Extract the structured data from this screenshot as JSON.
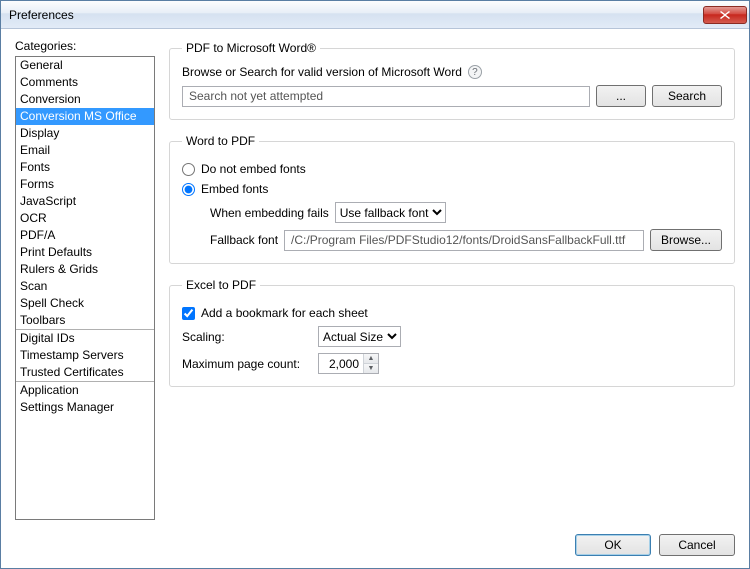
{
  "window": {
    "title": "Preferences"
  },
  "sidebar": {
    "label": "Categories:",
    "groups": [
      [
        "General",
        "Comments",
        "Conversion",
        "Conversion MS Office",
        "Display",
        "Email",
        "Fonts",
        "Forms",
        "JavaScript",
        "OCR",
        "PDF/A",
        "Print Defaults",
        "Rulers & Grids",
        "Scan",
        "Spell Check",
        "Toolbars"
      ],
      [
        "Digital IDs",
        "Timestamp Servers",
        "Trusted Certificates"
      ],
      [
        "Application",
        "Settings Manager"
      ]
    ],
    "selected": "Conversion MS Office"
  },
  "pdf_to_word": {
    "legend": "PDF to Microsoft Word®",
    "prompt": "Browse or Search for valid version of Microsoft Word",
    "status": "Search not yet attempted",
    "browse_label": "...",
    "search_label": "Search"
  },
  "word_to_pdf": {
    "legend": "Word to PDF",
    "radio_no_embed": "Do not embed fonts",
    "radio_embed": "Embed fonts",
    "embed_selected": true,
    "when_fails_label": "When embedding fails",
    "when_fails_value": "Use fallback font",
    "fallback_label": "Fallback font",
    "fallback_value": "/C:/Program Files/PDFStudio12/fonts/DroidSansFallbackFull.ttf",
    "browse_label": "Browse..."
  },
  "excel_to_pdf": {
    "legend": "Excel to PDF",
    "bookmark_label": "Add a bookmark for each sheet",
    "bookmark_checked": true,
    "scaling_label": "Scaling:",
    "scaling_value": "Actual Size",
    "max_page_label": "Maximum page count:",
    "max_page_value": "2,000"
  },
  "footer": {
    "ok": "OK",
    "cancel": "Cancel"
  }
}
